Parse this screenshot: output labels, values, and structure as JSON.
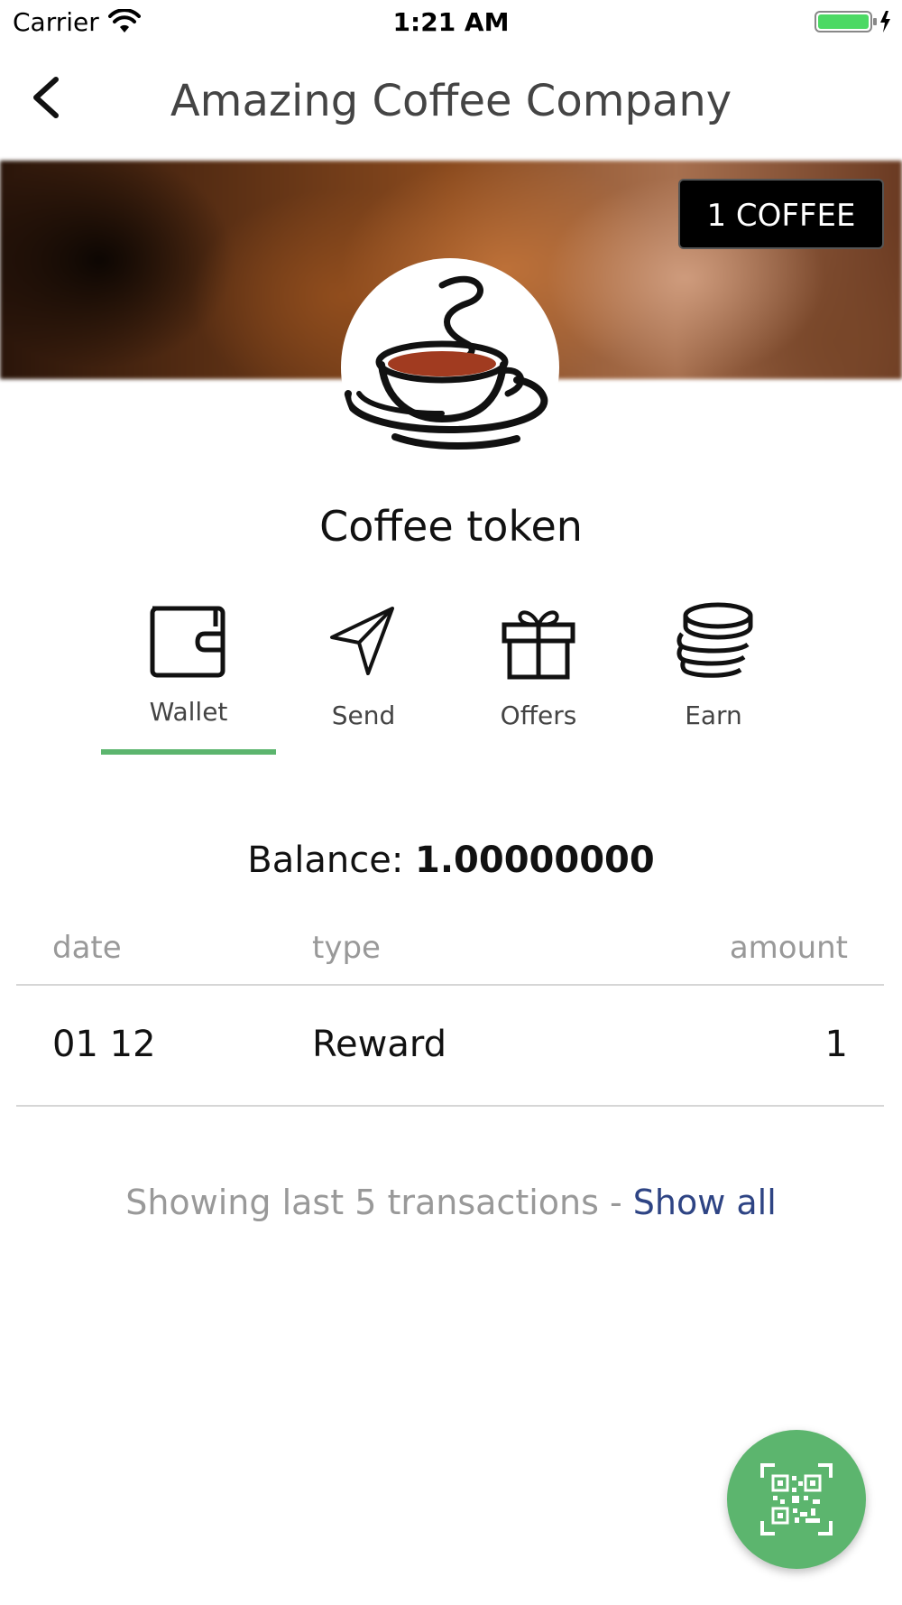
{
  "status_bar": {
    "carrier": "Carrier",
    "time": "1:21 AM"
  },
  "nav": {
    "title": "Amazing Coffee Company"
  },
  "banner": {
    "badge": "1 COFFEE"
  },
  "token": {
    "name": "Coffee token",
    "logo_icon": "coffee-cup-icon"
  },
  "tabs": [
    {
      "label": "Wallet",
      "icon": "wallet-icon",
      "active": true
    },
    {
      "label": "Send",
      "icon": "paper-plane-icon",
      "active": false
    },
    {
      "label": "Offers",
      "icon": "gift-icon",
      "active": false
    },
    {
      "label": "Earn",
      "icon": "coins-icon",
      "active": false
    }
  ],
  "balance": {
    "label": "Balance:",
    "value": "1.00000000"
  },
  "transactions": {
    "columns": {
      "date": "date",
      "type": "type",
      "amount": "amount"
    },
    "rows": [
      {
        "date": "01 12",
        "type": "Reward",
        "amount": "1"
      }
    ]
  },
  "footer": {
    "note": "Showing last 5 transactions - ",
    "show_all": "Show all"
  },
  "fab": {
    "icon": "qr-scan-icon"
  },
  "colors": {
    "accent_green": "#5cb56e",
    "link_blue": "#2e4484"
  }
}
